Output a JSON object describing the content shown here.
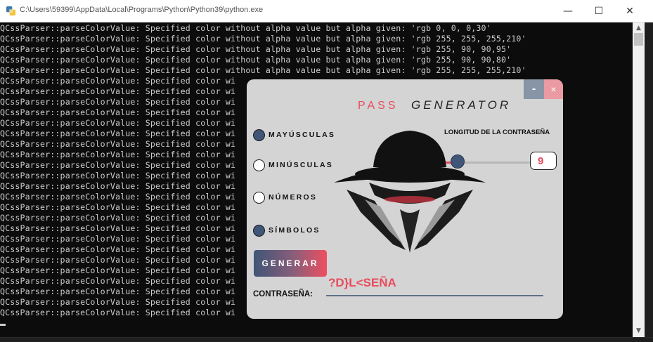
{
  "window": {
    "title": "C:\\Users\\59399\\AppData\\Local\\Programs\\Python\\Python39\\python.exe",
    "icon": "python-icon",
    "controls": {
      "minimize": "—",
      "maximize": "☐",
      "close": "✕"
    }
  },
  "console": {
    "lines": [
      "QCssParser::parseColorValue: Specified color without alpha value but alpha given: 'rgb 0, 0, 0,30'",
      "QCssParser::parseColorValue: Specified color without alpha value but alpha given: 'rgb 255, 255, 255,210'",
      "QCssParser::parseColorValue: Specified color without alpha value but alpha given: 'rgb 255, 90, 90,95'",
      "QCssParser::parseColorValue: Specified color without alpha value but alpha given: 'rgb 255, 90, 90,80'",
      "QCssParser::parseColorValue: Specified color without alpha value but alpha given: 'rgb 255, 255, 255,210'",
      "QCssParser::parseColorValue: Specified color wi",
      "QCssParser::parseColorValue: Specified color wi",
      "QCssParser::parseColorValue: Specified color wi",
      "QCssParser::parseColorValue: Specified color wi",
      "QCssParser::parseColorValue: Specified color wi",
      "QCssParser::parseColorValue: Specified color wi",
      "QCssParser::parseColorValue: Specified color wi",
      "QCssParser::parseColorValue: Specified color wi",
      "QCssParser::parseColorValue: Specified color wi",
      "QCssParser::parseColorValue: Specified color wi",
      "QCssParser::parseColorValue: Specified color wi",
      "QCssParser::parseColorValue: Specified color wi",
      "QCssParser::parseColorValue: Specified color wi",
      "QCssParser::parseColorValue: Specified color wi",
      "QCssParser::parseColorValue: Specified color wi",
      "QCssParser::parseColorValue: Specified color wi",
      "QCssParser::parseColorValue: Specified color wi",
      "QCssParser::parseColorValue: Specified color wi",
      "QCssParser::parseColorValue: Specified color wi",
      "QCssParser::parseColorValue: Specified color wi",
      "QCssParser::parseColorValue: Specified color wi",
      "QCssParser::parseColorValue: Specified color wi",
      "QCssParser::parseColorValue: Specified color wi"
    ]
  },
  "app": {
    "title_part1": "PASS",
    "title_part2": "GENERATOR",
    "minimize_label": "-",
    "close_label": "×",
    "options": [
      {
        "label": "MAYÚSCULAS",
        "checked": true
      },
      {
        "label": "MINÚSCULAS",
        "checked": false
      },
      {
        "label": "NÚMEROS",
        "checked": false
      },
      {
        "label": "SÍMBOLOS",
        "checked": true
      }
    ],
    "length_label": "LONGITUD DE LA CONTRASEÑA",
    "length_value": "9",
    "length_min": 4,
    "length_max": 40,
    "generate_label": "GENERAR",
    "generated_password": "?D}L<SEÑA",
    "password_label": "CONTRASEÑA:",
    "logo": "spy-hat-icon",
    "colors": {
      "accent": "#e84b5c",
      "primary": "#3f5677",
      "panel": "#d4d4d4"
    }
  }
}
